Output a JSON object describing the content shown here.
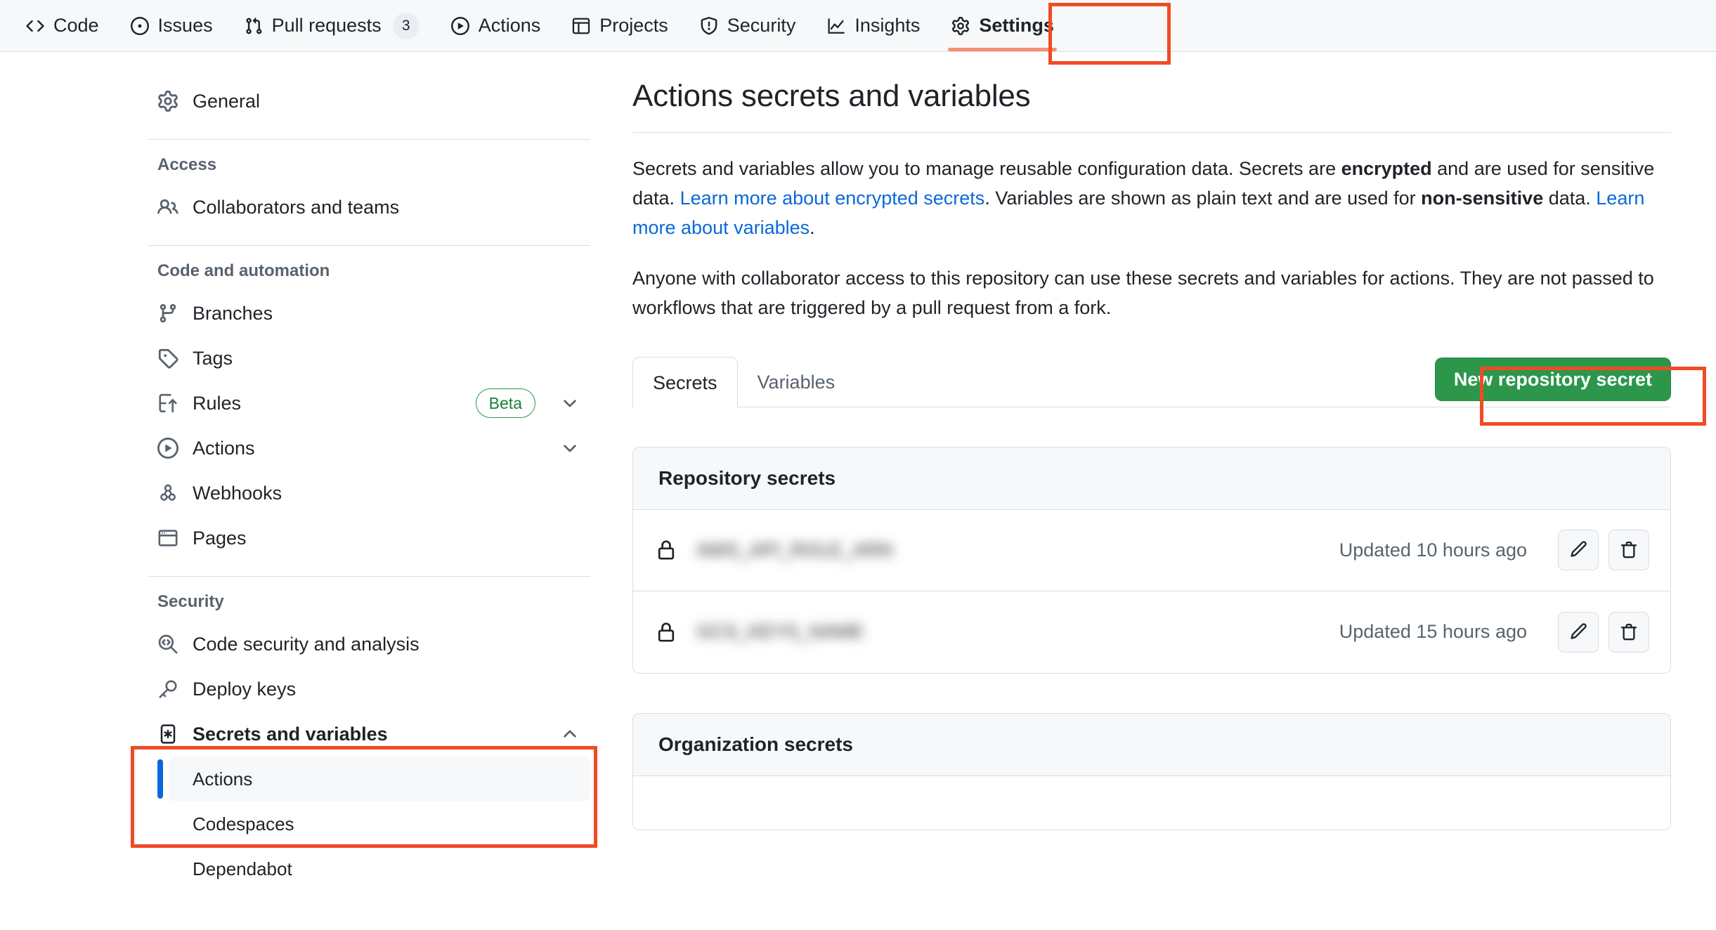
{
  "topnav": {
    "items": [
      {
        "label": "Code",
        "icon": "code-icon",
        "count": null,
        "selected": false
      },
      {
        "label": "Issues",
        "icon": "issue-icon",
        "count": null,
        "selected": false
      },
      {
        "label": "Pull requests",
        "icon": "git-pull-request-icon",
        "count": "3",
        "selected": false
      },
      {
        "label": "Actions",
        "icon": "play-icon",
        "count": null,
        "selected": false
      },
      {
        "label": "Projects",
        "icon": "table-icon",
        "count": null,
        "selected": false
      },
      {
        "label": "Security",
        "icon": "shield-icon",
        "count": null,
        "selected": false
      },
      {
        "label": "Insights",
        "icon": "graph-icon",
        "count": null,
        "selected": false
      },
      {
        "label": "Settings",
        "icon": "gear-icon",
        "count": null,
        "selected": true
      }
    ]
  },
  "sidebar": {
    "general": {
      "label": "General",
      "icon": "gear-icon"
    },
    "groups": [
      {
        "title": "Access",
        "items": [
          {
            "label": "Collaborators and teams",
            "icon": "people-icon"
          }
        ]
      },
      {
        "title": "Code and automation",
        "items": [
          {
            "label": "Branches",
            "icon": "git-branch-icon"
          },
          {
            "label": "Tags",
            "icon": "tag-icon"
          },
          {
            "label": "Rules",
            "icon": "rules-icon",
            "badge": "Beta",
            "chevron": "chevron-down-icon"
          },
          {
            "label": "Actions",
            "icon": "play-icon",
            "chevron": "chevron-down-icon"
          },
          {
            "label": "Webhooks",
            "icon": "webhook-icon"
          },
          {
            "label": "Pages",
            "icon": "browser-icon"
          }
        ]
      },
      {
        "title": "Security",
        "items": [
          {
            "label": "Code security and analysis",
            "icon": "codescan-icon"
          },
          {
            "label": "Deploy keys",
            "icon": "key-icon"
          }
        ]
      }
    ],
    "secrets_section": {
      "label": "Secrets and variables",
      "icon": "key-asterisk-icon",
      "chevron": "chevron-up-icon",
      "sub_items": [
        {
          "label": "Actions",
          "active": true
        },
        {
          "label": "Codespaces",
          "active": false
        },
        {
          "label": "Dependabot",
          "active": false
        }
      ]
    }
  },
  "main": {
    "title": "Actions secrets and variables",
    "intro": {
      "p1_part1": "Secrets and variables allow you to manage reusable configuration data. Secrets are ",
      "p1_bold1": "encrypted",
      "p1_part2": " and are used for sensitive data. ",
      "p1_link1": "Learn more about encrypted secrets",
      "p1_part3": ". Variables are shown as plain text and are used for ",
      "p1_bold2": "non-sensitive",
      "p1_part4": " data. ",
      "p1_link2": "Learn more about variables",
      "p1_part5": ".",
      "p2": "Anyone with collaborator access to this repository can use these secrets and variables for actions. They are not passed to workflows that are triggered by a pull request from a fork."
    },
    "tabs": [
      {
        "label": "Secrets",
        "active": true
      },
      {
        "label": "Variables",
        "active": false
      }
    ],
    "new_secret_button": "New repository secret",
    "repository_secrets": {
      "header": "Repository secrets",
      "rows": [
        {
          "name": "AWS_API_ROLE_ARN",
          "redacted": true,
          "updated": "Updated 10 hours ago",
          "edit_icon": "pencil-icon",
          "delete_icon": "trash-icon"
        },
        {
          "name": "GCS_KEYS_NAME",
          "redacted": true,
          "updated": "Updated 15 hours ago",
          "edit_icon": "pencil-icon",
          "delete_icon": "trash-icon"
        }
      ]
    },
    "organization_secrets": {
      "header": "Organization secrets"
    }
  },
  "annotations": {
    "settings_tab_highlight": "#f04b25",
    "new_secret_button_highlight": "#f04b25",
    "secrets_and_variables_highlight": "#f04b25"
  }
}
